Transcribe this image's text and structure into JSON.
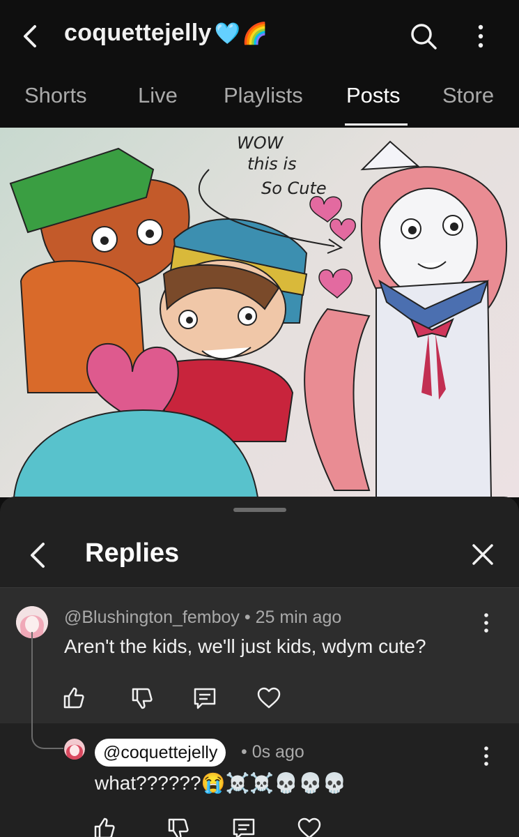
{
  "header": {
    "channel_name": "coquettejelly",
    "channel_emoji_1": "🩵",
    "channel_emoji_2": "🌈",
    "back_icon": "back-arrow-icon",
    "search_icon": "search-icon",
    "menu_icon": "more-vert-icon"
  },
  "tabs": [
    {
      "label": "Shorts",
      "active": false
    },
    {
      "label": "Live",
      "active": false
    },
    {
      "label": "Playlists",
      "active": false
    },
    {
      "label": "Posts",
      "active": true
    },
    {
      "label": "Store",
      "active": false
    }
  ],
  "post_image": {
    "caption_lines": [
      "WOW",
      "this is",
      "So Cute"
    ]
  },
  "replies_sheet": {
    "title": "Replies",
    "back_icon": "back-arrow-icon",
    "close_icon": "close-icon"
  },
  "comments": [
    {
      "author": "@Blushington_femboy",
      "time": "25 min ago",
      "text": "Aren't the kids, we'll just kids, wdym cute?"
    },
    {
      "author": "@coquettejelly",
      "time": "0s ago",
      "text": "what??????",
      "emojis": "😭☠️☠️💀💀💀"
    }
  ],
  "colors": {
    "background": "#0f0f0f",
    "sheet": "#212121",
    "highlighted_comment": "#2d2d2d",
    "secondary_text": "#aaaaaa",
    "accent_heart": "#5aa7e0"
  }
}
